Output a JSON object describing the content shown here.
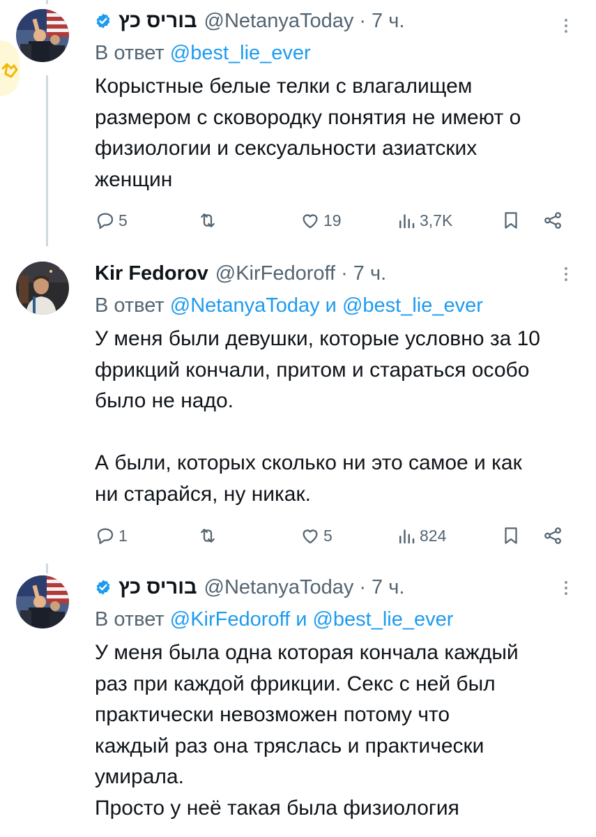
{
  "tweets": [
    {
      "display_name": "בוריס כץ",
      "handle": "@NetanyaToday",
      "time": "7 ч.",
      "verified": true,
      "reply_prefix": "В ответ",
      "reply_to_1": "@best_lie_ever",
      "reply_joiner": "",
      "reply_to_2": "",
      "body": "Корыстные белые телки с влагалищем\nразмером с сковородку понятия не имеют о\nфизиологии и сексуальности азиатских\nженщин",
      "replies": "5",
      "retweets": "",
      "likes": "19",
      "views": "3,7K"
    },
    {
      "display_name": "Kir Fedorov",
      "handle": "@KirFedoroff",
      "time": "7 ч.",
      "verified": false,
      "reply_prefix": "В ответ",
      "reply_to_1": "@NetanyaToday",
      "reply_joiner": "и",
      "reply_to_2": "@best_lie_ever",
      "body": "У меня были девушки, которые условно за 10\nфрикций кончали, притом и стараться особо\nбыло не надо.\n\nА были, которых сколько ни это самое и как\nни старайся, ну никак.",
      "replies": "1",
      "retweets": "",
      "likes": "5",
      "views": "824"
    },
    {
      "display_name": "בוריס כץ",
      "handle": "@NetanyaToday",
      "time": "7 ч.",
      "verified": true,
      "reply_prefix": "В ответ",
      "reply_to_1": "@KirFedoroff",
      "reply_joiner": "и",
      "reply_to_2": "@best_lie_ever",
      "body": "У меня была одна которая кончала каждый\nраз при каждой фрикции. Секс с ней был\nпрактически невозможен потому что\nкаждый раз она тряслась и практически\nумирала.\nПросто у неё такая была физиология"
    }
  ],
  "separator": "·",
  "colors": {
    "accent": "#1d9bf0",
    "secondary_text": "#536471",
    "thread_line": "#cfd9de"
  },
  "icons": [
    "verified-badge-icon",
    "more-options-icon",
    "reply-icon",
    "retweet-icon",
    "like-icon",
    "views-icon",
    "bookmark-icon",
    "share-icon"
  ]
}
